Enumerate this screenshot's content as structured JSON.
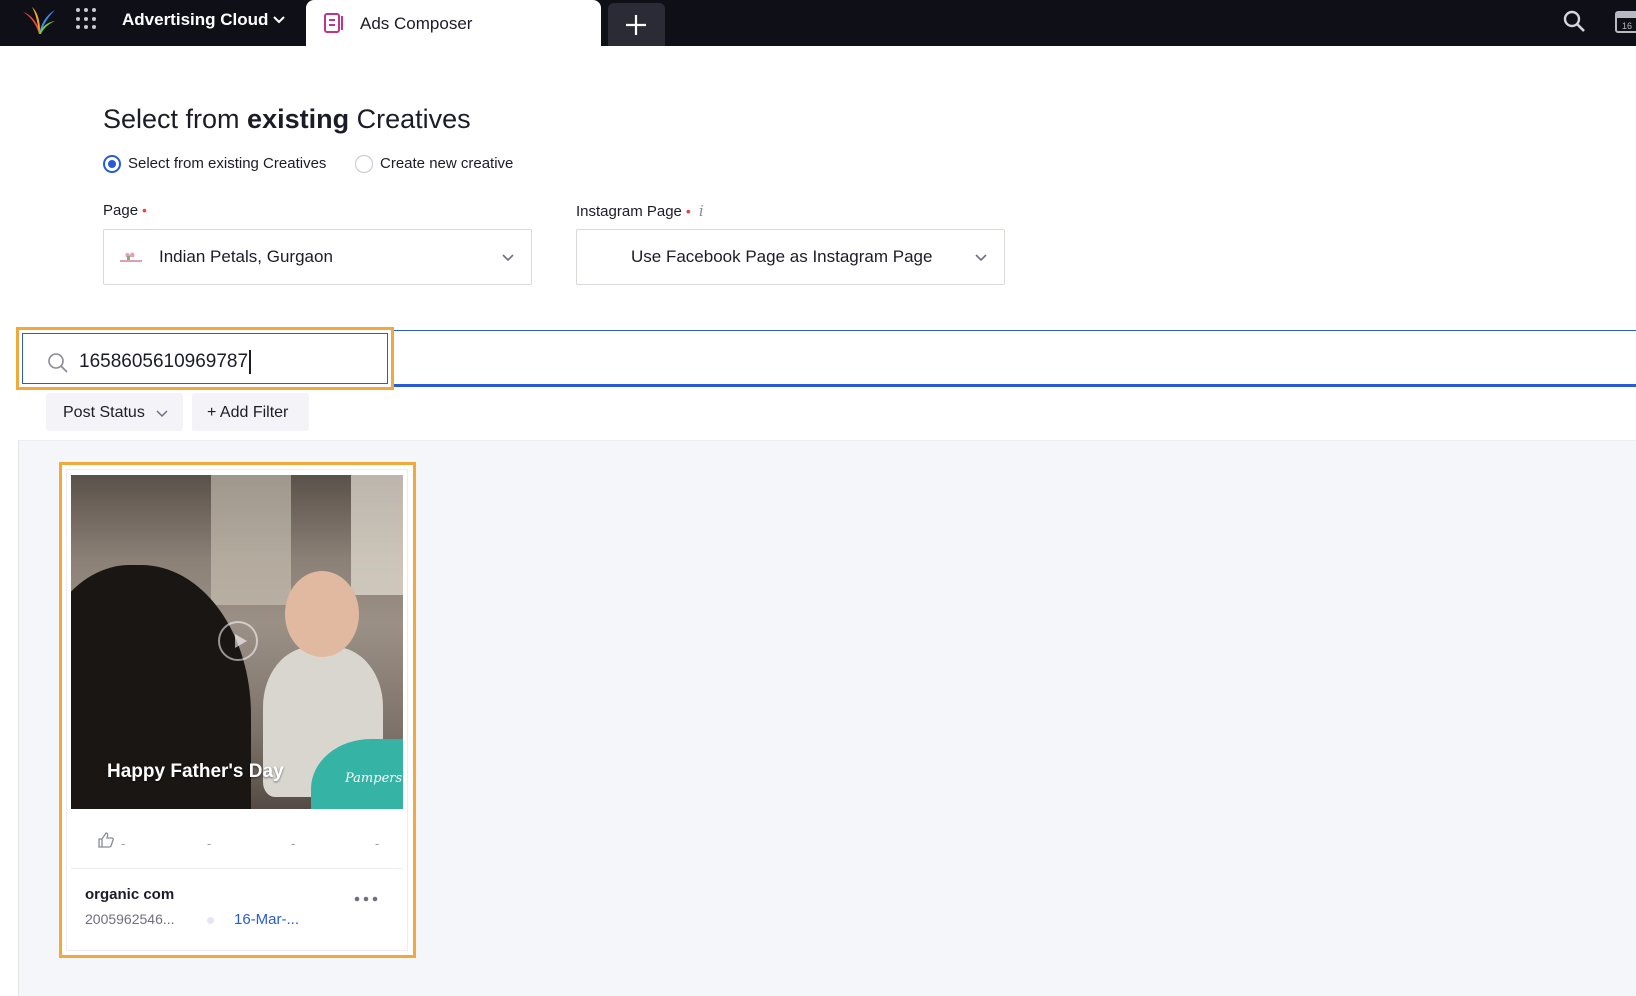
{
  "topbar": {
    "app_name": "Advertising Cloud",
    "tab_label": "Ads Composer",
    "calendar_day": "16",
    "icons": [
      "sprinklr-logo-icon",
      "app-grid-icon",
      "chevron-down-icon",
      "ads-composer-icon",
      "plus-icon",
      "search-icon",
      "calendar-icon"
    ]
  },
  "header": {
    "title_prefix": "Select from ",
    "title_bold": "existing",
    "title_suffix": " Creatives",
    "radio_existing": "Select from existing Creatives",
    "radio_new": "Create new creative",
    "selected_option": "Select from existing Creatives"
  },
  "fields": {
    "page_label": "Page",
    "page_value": "Indian Petals, Gurgaon",
    "instagram_label": "Instagram Page",
    "instagram_value": "Use Facebook Page as Instagram Page",
    "required_mark": "•",
    "info_mark": "i"
  },
  "search": {
    "value": "1658605610969787"
  },
  "filters": {
    "post_status": "Post Status",
    "add_filter": "+ Add Filter"
  },
  "card": {
    "caption": "Happy Father's Day",
    "brand": "Pampers",
    "stats": [
      "-",
      "-",
      "-",
      "-"
    ],
    "name": "organic com",
    "id": "2005962546...",
    "date": "16-Mar-..."
  },
  "colors": {
    "topbar_bg": "#0f0f17",
    "accent_blue": "#2a5bd7",
    "highlight_orange": "#f2a93b",
    "required_red": "#e8453c"
  }
}
